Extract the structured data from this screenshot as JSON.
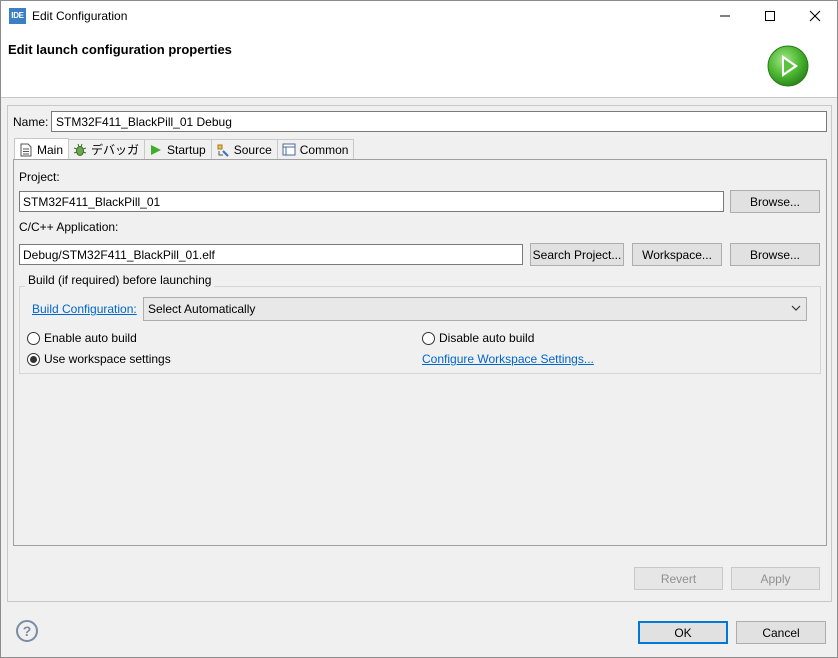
{
  "window": {
    "app_icon_text": "IDE",
    "title": "Edit Configuration",
    "minimize_icon": "minimize-icon",
    "maximize_icon": "maximize-icon",
    "close_icon": "close-icon"
  },
  "header": {
    "title": "Edit launch configuration properties",
    "icon": "run-icon"
  },
  "name": {
    "label": "Name:",
    "value": "STM32F411_BlackPill_01 Debug"
  },
  "tabs": [
    {
      "label": "Main",
      "icon": "document-icon",
      "active": true
    },
    {
      "label": "デバッガ",
      "icon": "bug-icon",
      "active": false
    },
    {
      "label": "Startup",
      "icon": "play-icon",
      "active": false
    },
    {
      "label": "Source",
      "icon": "source-icon",
      "active": false
    },
    {
      "label": "Common",
      "icon": "common-icon",
      "active": false
    }
  ],
  "main_tab": {
    "project_label": "Project:",
    "project_value": "STM32F411_BlackPill_01",
    "project_browse": "Browse...",
    "app_label": "C/C++ Application:",
    "app_value": "Debug/STM32F411_BlackPill_01.elf",
    "search_project": "Search Project...",
    "workspace": "Workspace...",
    "app_browse": "Browse...",
    "build_group": {
      "label": "Build (if required) before launching",
      "build_config_link": "Build Configuration:",
      "build_config_value": "Select Automatically",
      "enable_auto_build": "Enable auto build",
      "disable_auto_build": "Disable auto build",
      "use_workspace_settings": "Use workspace settings",
      "configure_link": "Configure Workspace Settings...",
      "selected": "use_workspace_settings"
    }
  },
  "actions": {
    "revert": "Revert",
    "apply": "Apply",
    "ok": "OK",
    "cancel": "Cancel",
    "help": "?"
  },
  "colors": {
    "link": "#0066cc",
    "accent": "#0078d7",
    "run_icon": "#3fae2a"
  }
}
